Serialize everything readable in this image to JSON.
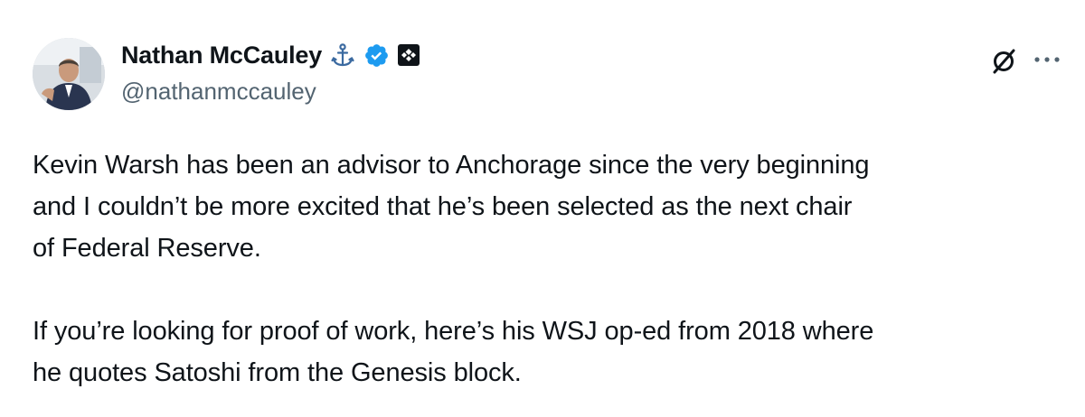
{
  "tweet": {
    "author": {
      "display_name": "Nathan McCauley",
      "handle": "@nathanmccauley",
      "badges": [
        "anchor-icon",
        "verified-badge-icon",
        "affiliate-badge-icon"
      ],
      "verified_color": "#1d9bf0"
    },
    "actions": {
      "grok_icon": "grok-icon",
      "more_icon": "more-options-icon"
    },
    "text": {
      "paragraph_1": "Kevin Warsh has been an advisor to Anchorage since the very beginning\nand I couldn’t be more excited that he’s been selected as the next chair\nof Federal Reserve.",
      "paragraph_2": "If you’re looking for proof of work, here’s his WSJ op-ed from 2018 where\nhe quotes Satoshi from the Genesis block."
    }
  }
}
